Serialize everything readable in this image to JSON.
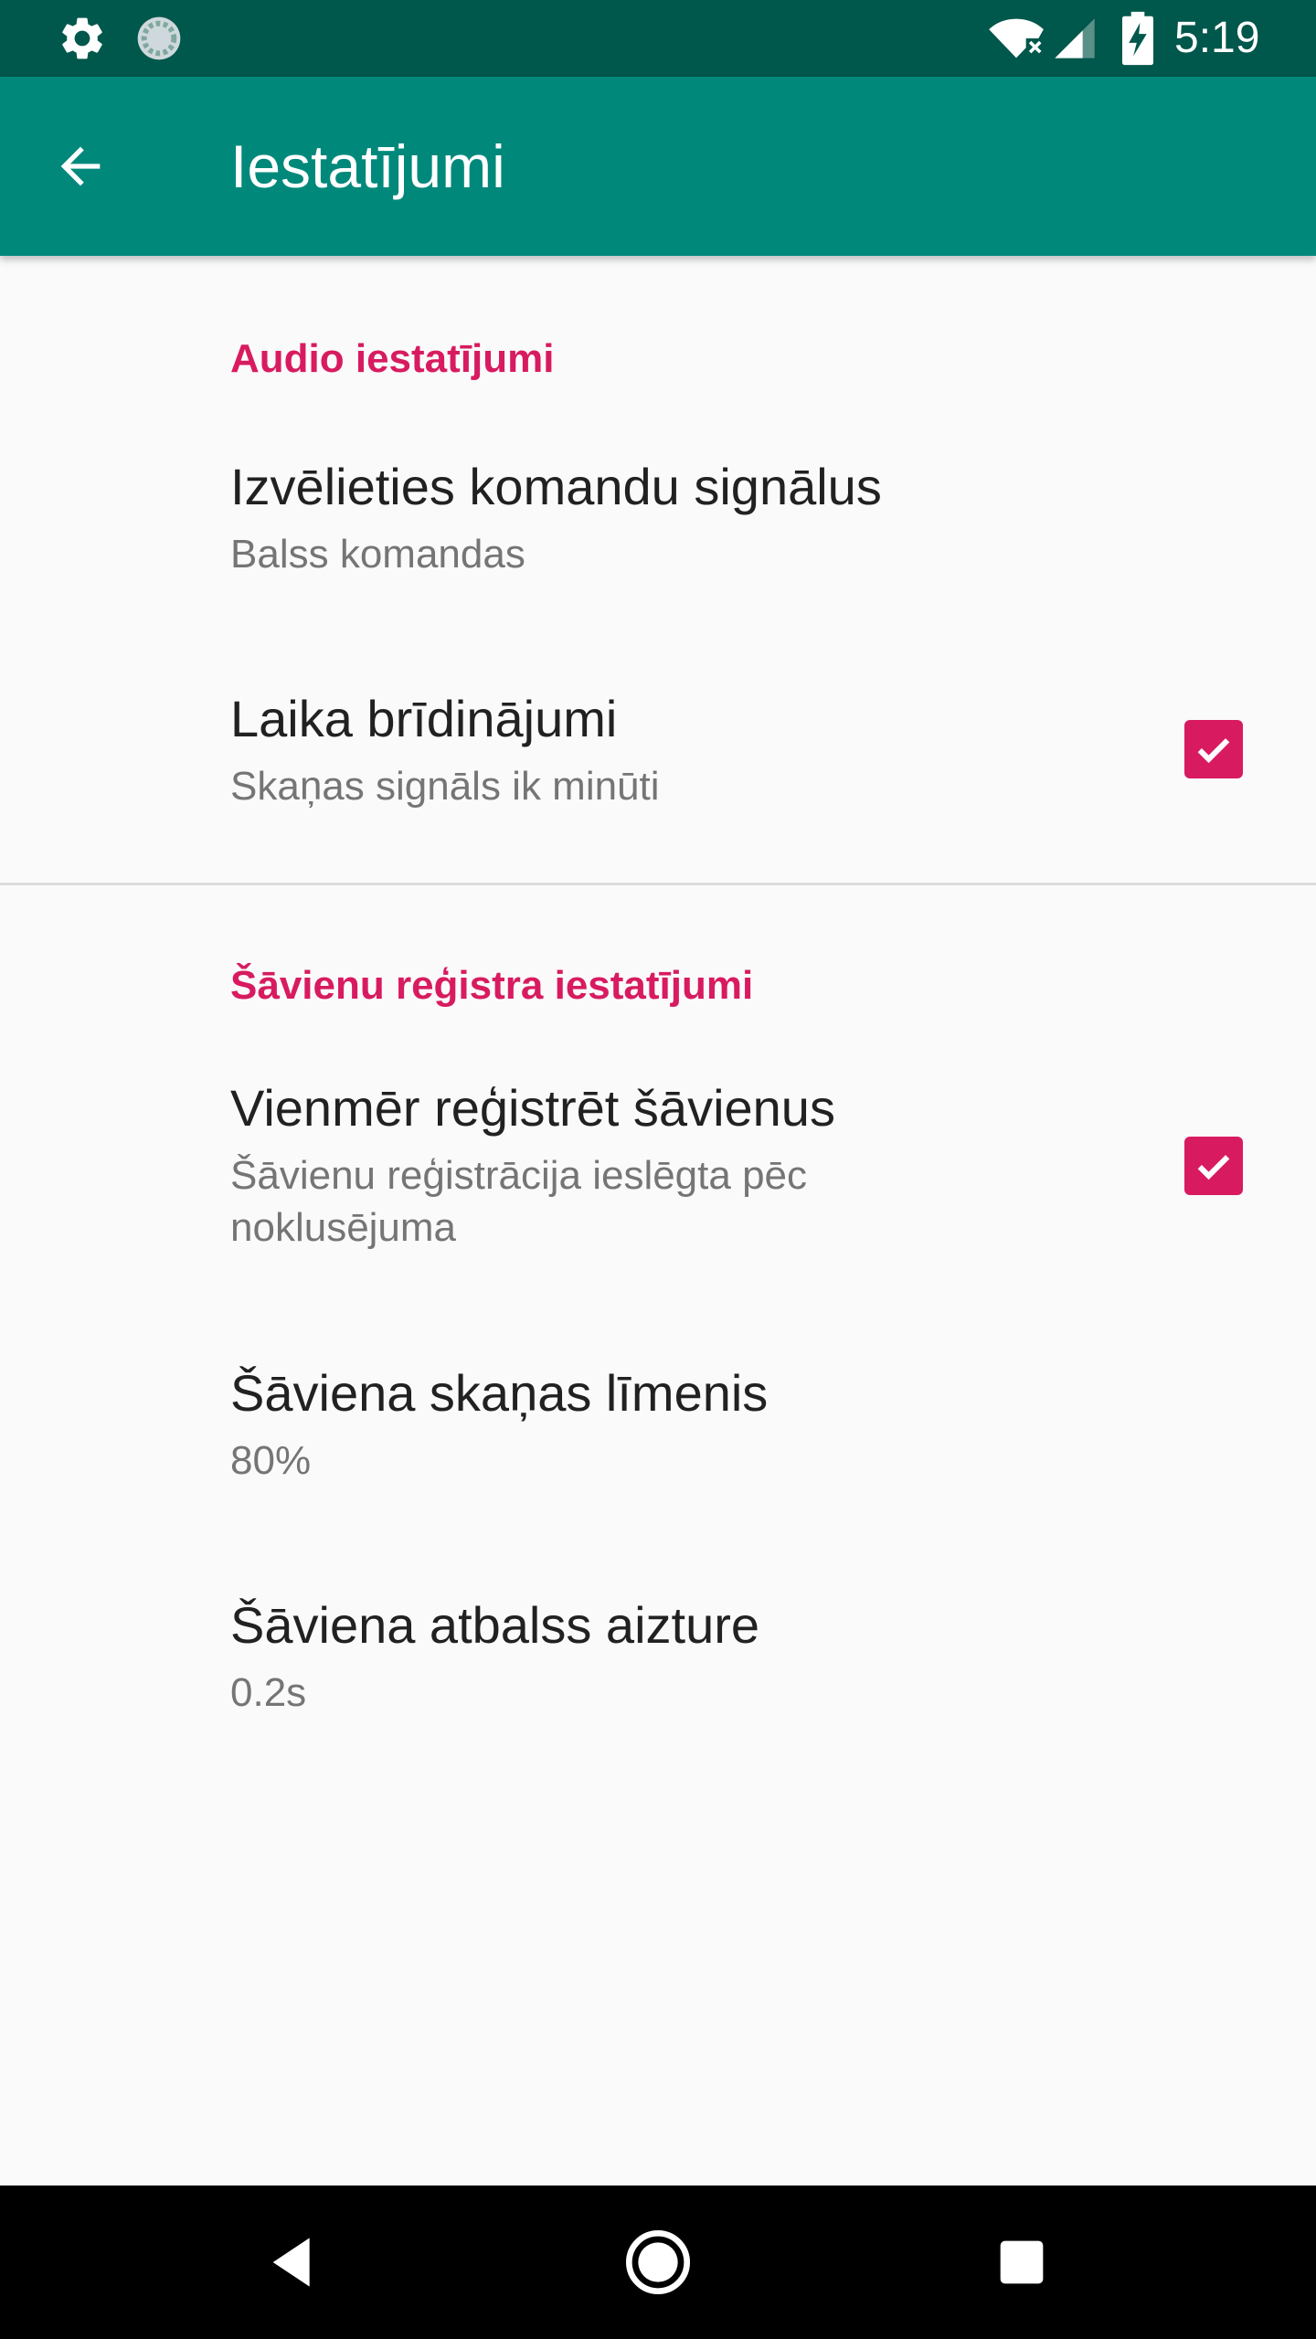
{
  "status_bar": {
    "time": "5:19",
    "left_icons": [
      "gear-icon",
      "sync-icon"
    ],
    "right_icons": [
      "wifi-off-icon",
      "cell-signal-icon",
      "battery-charging-icon"
    ]
  },
  "toolbar": {
    "title": "Iestatījumi",
    "back_icon": "arrow-back-icon"
  },
  "sections": [
    {
      "header": "Audio iestatījumi",
      "items": [
        {
          "title": "Izvēlieties komandu signālus",
          "summary": "Balss komandas",
          "has_checkbox": false
        },
        {
          "title": "Laika brīdinājumi",
          "summary": "Skaņas signāls ik minūti",
          "has_checkbox": true,
          "checked": true
        }
      ]
    },
    {
      "header": "Šāvienu reģistra iestatījumi",
      "items": [
        {
          "title": "Vienmēr reģistrēt šāvienus",
          "summary_line1": "Šāvienu reģistrācija ieslēgta pēc",
          "summary_line2": "noklusējuma",
          "has_checkbox": true,
          "checked": true
        },
        {
          "title": "Šāviena skaņas līmenis",
          "summary": "80%",
          "has_checkbox": false
        },
        {
          "title": "Šāviena atbalss aizture",
          "summary": "0.2s",
          "has_checkbox": false
        }
      ]
    }
  ],
  "nav_bar": {
    "icons": [
      "nav-back-icon",
      "nav-home-icon",
      "nav-recents-icon"
    ]
  },
  "colors": {
    "status_bar": "#00574b",
    "toolbar": "#00897b",
    "accent": "#d81b60",
    "background": "#fafafa",
    "title_text": "#212121",
    "summary_text": "#757575"
  }
}
